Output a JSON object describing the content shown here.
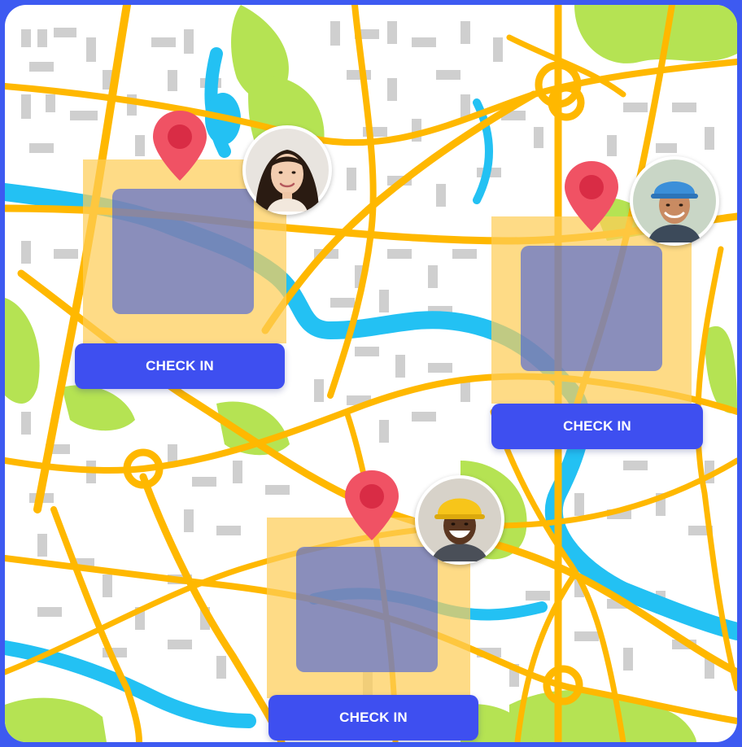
{
  "colors": {
    "frame": "#3d5af1",
    "map_background": "#ffffff",
    "park": "#b5e353",
    "river": "#23c1f3",
    "road": "#ffb800",
    "block": "#cfcfcf",
    "zone_outer": "#fdcd58",
    "zone_inner": "#4260dc",
    "pin": "#f05264",
    "pin_dot": "#d92c45",
    "button": "#3e4ff0",
    "button_text": "#ffffff"
  },
  "checkpoints": [
    {
      "pin_icon": "location-pin-icon",
      "avatar": "woman-portrait",
      "button_label": "CHECK IN"
    },
    {
      "pin_icon": "location-pin-icon",
      "avatar": "worker-blue-helmet-portrait",
      "button_label": "CHECK IN"
    },
    {
      "pin_icon": "location-pin-icon",
      "avatar": "worker-yellow-helmet-portrait",
      "button_label": "CHECK IN"
    }
  ]
}
